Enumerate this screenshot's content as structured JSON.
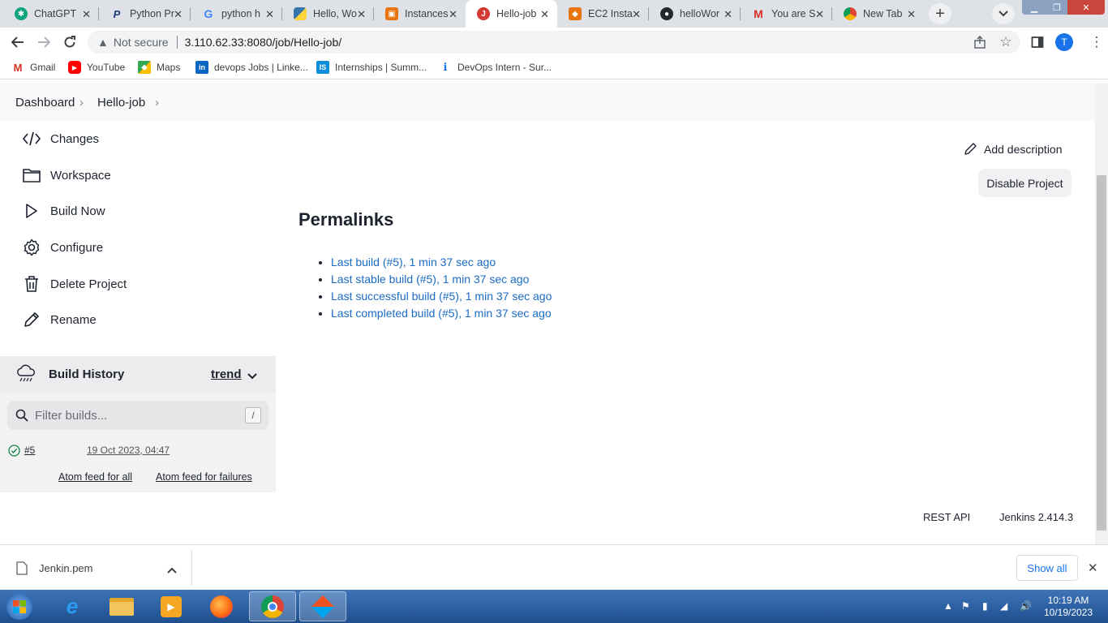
{
  "browser": {
    "tabs": [
      {
        "title": "ChatGPT",
        "icon": "chatgpt-icon",
        "color": "#10a37f",
        "active": false
      },
      {
        "title": "Python Pr",
        "icon": "paypal-icon",
        "color": "#ffffff",
        "active": false
      },
      {
        "title": "python h",
        "icon": "google-icon",
        "color": "#ffffff",
        "active": false
      },
      {
        "title": "Hello, Wo",
        "icon": "python-icon",
        "color": "#3776ab",
        "active": false
      },
      {
        "title": "Instances",
        "icon": "aws-ec2-icon",
        "color": "#e8750f",
        "active": false
      },
      {
        "title": "Hello-job",
        "icon": "jenkins-icon",
        "color": "#ffffff",
        "active": true
      },
      {
        "title": "EC2 Insta",
        "icon": "aws-box-icon",
        "color": "#e8750f",
        "active": false
      },
      {
        "title": "helloWor",
        "icon": "github-icon",
        "color": "#24292f",
        "active": false
      },
      {
        "title": "You are S",
        "icon": "gmail-icon",
        "color": "#ffffff",
        "active": false
      },
      {
        "title": "New Tab",
        "icon": "chrome-icon",
        "color": "#ffffff",
        "active": false
      }
    ],
    "security_label": "Not secure",
    "url": "3.110.62.33:8080/job/Hello-job/",
    "profile_initial": "T",
    "bookmarks": [
      {
        "label": "Gmail",
        "icon": "gmail-icon"
      },
      {
        "label": "YouTube",
        "icon": "youtube-icon"
      },
      {
        "label": "Maps",
        "icon": "maps-icon"
      },
      {
        "label": "devops Jobs | Linke...",
        "icon": "linkedin-icon"
      },
      {
        "label": "Internships | Summ...",
        "icon": "internshala-icon"
      },
      {
        "label": "DevOps Intern - Sur...",
        "icon": "info-icon"
      }
    ]
  },
  "jenkins": {
    "breadcrumb": {
      "dashboard": "Dashboard",
      "job": "Hello-job"
    },
    "sidebar": [
      {
        "label": "Changes",
        "icon": "code-icon"
      },
      {
        "label": "Workspace",
        "icon": "folder-icon"
      },
      {
        "label": "Build Now",
        "icon": "play-icon"
      },
      {
        "label": "Configure",
        "icon": "gear-icon"
      },
      {
        "label": "Delete Project",
        "icon": "trash-icon"
      },
      {
        "label": "Rename",
        "icon": "pencil-icon"
      }
    ],
    "build_history": {
      "title": "Build History",
      "trend": "trend",
      "filter_placeholder": "Filter builds...",
      "shortcut": "/",
      "builds": [
        {
          "number": "#5",
          "date": "19 Oct 2023, 04:47",
          "status": "success"
        }
      ],
      "atom_all": "Atom feed for all",
      "atom_failures": "Atom feed for failures"
    },
    "add_description": "Add description",
    "disable_project": "Disable Project",
    "permalinks_title": "Permalinks",
    "permalinks": [
      "Last build (#5), 1 min 37 sec ago",
      "Last stable build (#5), 1 min 37 sec ago",
      "Last successful build (#5), 1 min 37 sec ago",
      "Last completed build (#5), 1 min 37 sec ago"
    ],
    "footer": {
      "rest_api": "REST API",
      "version": "Jenkins 2.414.3"
    }
  },
  "downloads": {
    "file": "Jenkin.pem",
    "show_all": "Show all"
  },
  "taskbar": {
    "time": "10:19 AM",
    "date": "10/19/2023"
  },
  "colors": {
    "link": "#1a6bc4",
    "success": "#138347",
    "accent": "#1a73e8"
  }
}
